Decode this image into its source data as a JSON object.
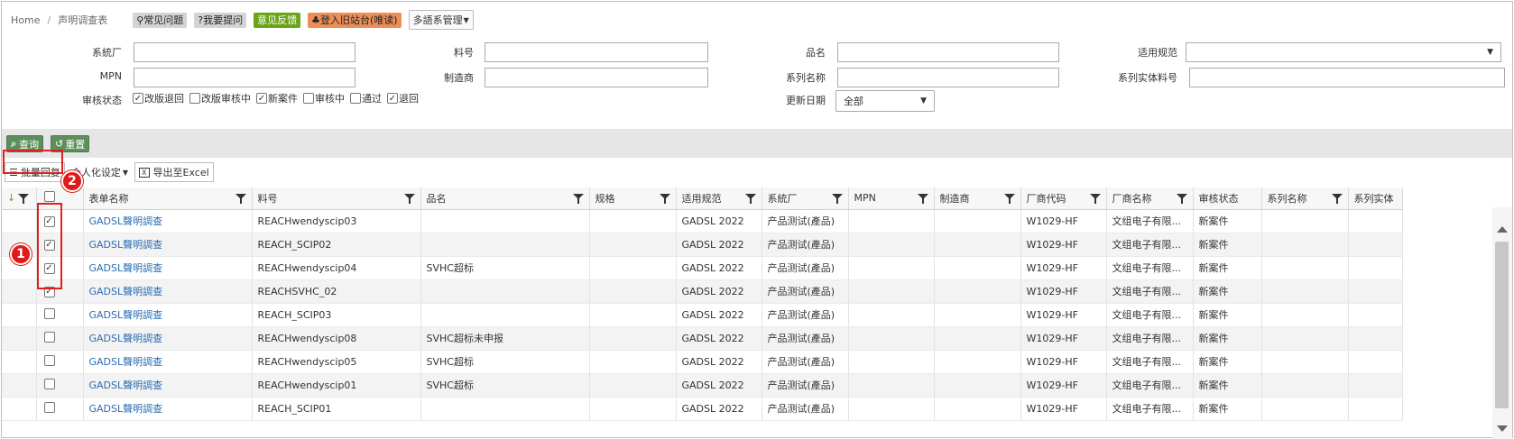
{
  "breadcrumb": {
    "home": "Home",
    "current": "声明调查表"
  },
  "topbar": {
    "faq": "常见问题",
    "ask": "我要提问",
    "feedback": "意见反馈",
    "old_site": "登入旧站台(唯读)",
    "lang_select": "多語系管理"
  },
  "filters": {
    "supplier_label": "系統厂",
    "partno_label": "料号",
    "partname_label": "品名",
    "regulation_label": "适用规范",
    "mpn_label": "MPN",
    "manufacturer_label": "制造商",
    "series_name_label": "系列名称",
    "series_partno_label": "系列实体料号",
    "status_label": "审核状态",
    "update_date_label": "更新日期",
    "update_date_value": "全部",
    "status_options": [
      {
        "label": "改版退回",
        "checked": true
      },
      {
        "label": "改版审核中",
        "checked": false
      },
      {
        "label": "新案件",
        "checked": true
      },
      {
        "label": "审核中",
        "checked": false
      },
      {
        "label": "通过",
        "checked": false
      },
      {
        "label": "退回",
        "checked": true
      }
    ]
  },
  "actions": {
    "query": "查询",
    "reset": "重置"
  },
  "toolbar": {
    "batch_reply": "批量回复",
    "personalize": "个人化设定",
    "export": "导出至Excel"
  },
  "annotations": {
    "badge1": "1",
    "badge2": "2"
  },
  "grid": {
    "columns": [
      "表单名称",
      "料号",
      "品名",
      "规格",
      "适用规范",
      "系統厂",
      "MPN",
      "制造商",
      "厂商代码",
      "厂商名称",
      "审核状态",
      "系列名称",
      "系列实体"
    ],
    "rows": [
      {
        "checked": true,
        "form": "GADSL聲明調查",
        "partno": "REACHwendyscip03",
        "name": "",
        "spec": "",
        "reg": "GADSL 2022",
        "supplier": "产品测试(產品)",
        "mpn": "",
        "mfr": "",
        "vcode": "W1029-HF",
        "vname": "文组电子有限...",
        "status": "新案件",
        "series": "",
        "series_no": ""
      },
      {
        "checked": true,
        "form": "GADSL聲明調查",
        "partno": "REACH_SCIP02",
        "name": "",
        "spec": "",
        "reg": "GADSL 2022",
        "supplier": "产品测试(產品)",
        "mpn": "",
        "mfr": "",
        "vcode": "W1029-HF",
        "vname": "文组电子有限...",
        "status": "新案件",
        "series": "",
        "series_no": ""
      },
      {
        "checked": true,
        "form": "GADSL聲明調查",
        "partno": "REACHwendyscip04",
        "name": "SVHC超标",
        "spec": "",
        "reg": "GADSL 2022",
        "supplier": "产品测试(產品)",
        "mpn": "",
        "mfr": "",
        "vcode": "W1029-HF",
        "vname": "文组电子有限...",
        "status": "新案件",
        "series": "",
        "series_no": ""
      },
      {
        "checked": true,
        "form": "GADSL聲明調查",
        "partno": "REACHSVHC_02",
        "name": "",
        "spec": "",
        "reg": "GADSL 2022",
        "supplier": "产品测试(產品)",
        "mpn": "",
        "mfr": "",
        "vcode": "W1029-HF",
        "vname": "文组电子有限...",
        "status": "新案件",
        "series": "",
        "series_no": ""
      },
      {
        "checked": false,
        "form": "GADSL聲明調查",
        "partno": "REACH_SCIP03",
        "name": "",
        "spec": "",
        "reg": "GADSL 2022",
        "supplier": "产品测试(產品)",
        "mpn": "",
        "mfr": "",
        "vcode": "W1029-HF",
        "vname": "文组电子有限...",
        "status": "新案件",
        "series": "",
        "series_no": ""
      },
      {
        "checked": false,
        "form": "GADSL聲明調查",
        "partno": "REACHwendyscip08",
        "name": "SVHC超标未申报",
        "spec": "",
        "reg": "GADSL 2022",
        "supplier": "产品测试(產品)",
        "mpn": "",
        "mfr": "",
        "vcode": "W1029-HF",
        "vname": "文组电子有限...",
        "status": "新案件",
        "series": "",
        "series_no": ""
      },
      {
        "checked": false,
        "form": "GADSL聲明調查",
        "partno": "REACHwendyscip05",
        "name": "SVHC超标",
        "spec": "",
        "reg": "GADSL 2022",
        "supplier": "产品测试(產品)",
        "mpn": "",
        "mfr": "",
        "vcode": "W1029-HF",
        "vname": "文组电子有限...",
        "status": "新案件",
        "series": "",
        "series_no": ""
      },
      {
        "checked": false,
        "form": "GADSL聲明調查",
        "partno": "REACHwendyscip01",
        "name": "SVHC超标",
        "spec": "",
        "reg": "GADSL 2022",
        "supplier": "产品测试(產品)",
        "mpn": "",
        "mfr": "",
        "vcode": "W1029-HF",
        "vname": "文组电子有限...",
        "status": "新案件",
        "series": "",
        "series_no": ""
      },
      {
        "checked": false,
        "form": "GADSL聲明調查",
        "partno": "REACH_SCIP01",
        "name": "",
        "spec": "",
        "reg": "GADSL 2022",
        "supplier": "产品测试(產品)",
        "mpn": "",
        "mfr": "",
        "vcode": "W1029-HF",
        "vname": "文组电子有限...",
        "status": "新案件",
        "series": "",
        "series_no": ""
      }
    ]
  },
  "colors": {
    "link": "#2a6db0",
    "green_button": "#5c8f5c",
    "annotation_red": "#e01919",
    "feedback_green": "#6aa417",
    "old_site_orange": "#ec8e58"
  }
}
